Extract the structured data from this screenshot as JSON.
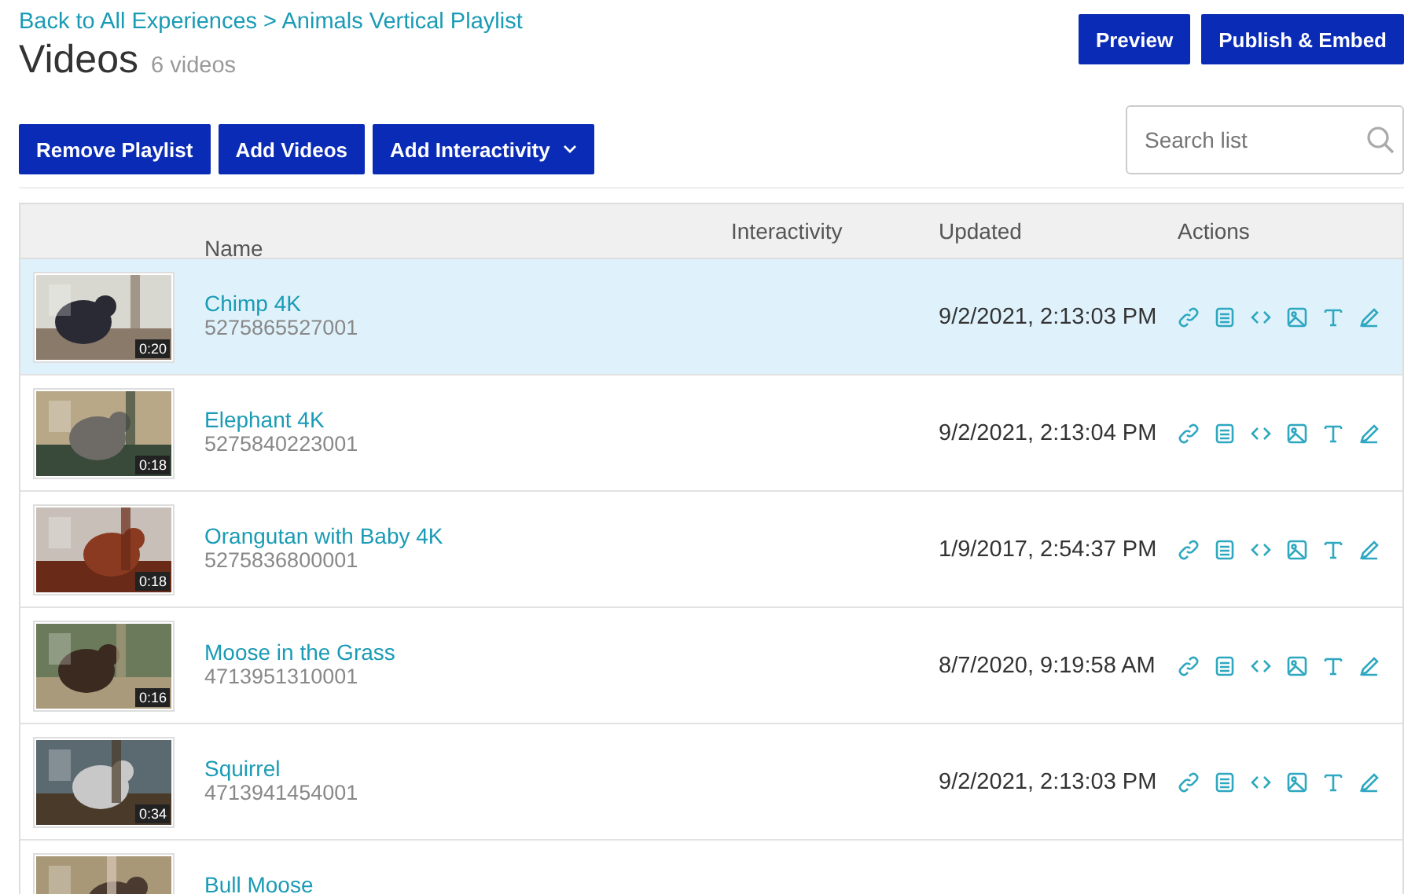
{
  "breadcrumb": "Back to All Experiences > Animals Vertical Playlist",
  "title": "Videos",
  "count": "6 videos",
  "header_buttons": [
    "Preview",
    "Publish & Embed"
  ],
  "toolbar_buttons": [
    {
      "label": "Remove Playlist",
      "kind": "plain"
    },
    {
      "label": "Add Videos",
      "kind": "plain"
    },
    {
      "label": "Add Interactivity",
      "kind": "dropdown"
    }
  ],
  "search": {
    "placeholder": "Search list"
  },
  "table": {
    "columns": [
      "Name",
      "Interactivity",
      "Updated",
      "Actions"
    ],
    "rows": [
      {
        "name": "Chimp 4K",
        "id": "5275865527001",
        "duration": "0:20",
        "updated": "9/2/2021, 2:13:03 PM",
        "selected": true
      },
      {
        "name": "Elephant 4K",
        "id": "5275840223001",
        "duration": "0:18",
        "updated": "9/2/2021, 2:13:04 PM",
        "selected": false
      },
      {
        "name": "Orangutan with Baby 4K",
        "id": "5275836800001",
        "duration": "0:18",
        "updated": "1/9/2017, 2:54:37 PM",
        "selected": false
      },
      {
        "name": "Moose in the Grass",
        "id": "4713951310001",
        "duration": "0:16",
        "updated": "8/7/2020, 9:19:58 AM",
        "selected": false
      },
      {
        "name": "Squirrel",
        "id": "4713941454001",
        "duration": "0:34",
        "updated": "9/2/2021, 2:13:03 PM",
        "selected": false
      },
      {
        "name": "Bull Moose",
        "selected": false
      }
    ]
  }
}
